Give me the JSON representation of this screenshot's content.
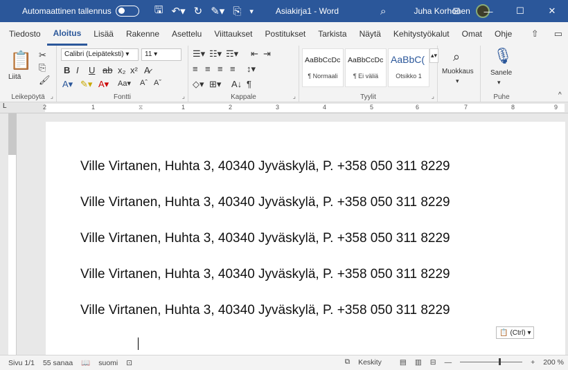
{
  "titlebar": {
    "autosave_label": "Automaattinen tallennus",
    "doc_title": "Asiakirja1 - Word",
    "user_name": "Juha Korhonen"
  },
  "tabs": [
    "Tiedosto",
    "Aloitus",
    "Lisää",
    "Rakenne",
    "Asettelu",
    "Viittaukset",
    "Postitukset",
    "Tarkista",
    "Näytä",
    "Kehitystyökalut",
    "Omat",
    "Ohje"
  ],
  "active_tab": "Aloitus",
  "ribbon": {
    "clipboard": {
      "label": "Leikepöytä",
      "paste": "Liitä"
    },
    "font": {
      "label": "Fontti",
      "font_name": "Calibri (Leipäteksti)",
      "font_size": "11"
    },
    "paragraph": {
      "label": "Kappale"
    },
    "styles": {
      "label": "Tyylit",
      "cards": [
        {
          "preview": "AaBbCcDc",
          "name": "¶ Normaali"
        },
        {
          "preview": "AaBbCcDc",
          "name": "¶ Ei väliä"
        },
        {
          "preview": "AaBbC(",
          "name": "Otsikko 1"
        }
      ]
    },
    "editing": {
      "label": "Muokkaus"
    },
    "voice": {
      "label": "Puhe",
      "dictate": "Sanele"
    }
  },
  "ruler_numbers": [
    "2",
    "1",
    "1",
    "2",
    "3",
    "4",
    "5",
    "6",
    "7",
    "8",
    "9"
  ],
  "document": {
    "lines": [
      "Ville Virtanen, Huhta 3, 40340 Jyväskylä, P. +358 050 311 8229",
      "Ville Virtanen, Huhta 3, 40340 Jyväskylä, P. +358 050 311 8229",
      "Ville Virtanen, Huhta 3, 40340 Jyväskylä, P. +358 050 311 8229",
      "Ville Virtanen, Huhta 3, 40340 Jyväskylä, P. +358 050 311 8229",
      "Ville Virtanen, Huhta 3, 40340 Jyväskylä, P. +358 050 311 8229"
    ],
    "paste_options": "(Ctrl) ▾"
  },
  "status": {
    "page": "Sivu 1/1",
    "words": "55 sanaa",
    "language": "suomi",
    "focus": "Keskity",
    "zoom": "200 %"
  },
  "colors": {
    "accent": "#2b579a"
  }
}
